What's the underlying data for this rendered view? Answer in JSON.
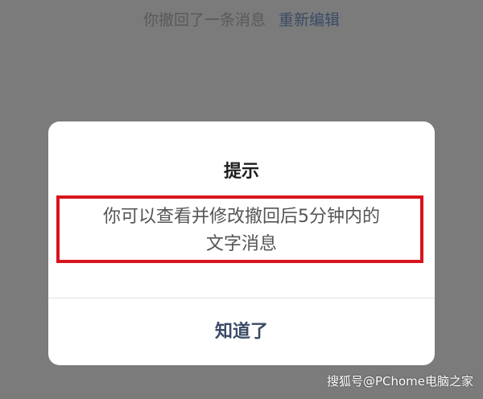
{
  "recall_notice": {
    "text": "你撤回了一条消息",
    "reedit_link": "重新编辑"
  },
  "dialog": {
    "title": "提示",
    "message_line1": "你可以查看并修改撤回后5分钟内的",
    "message_line2": "文字消息",
    "confirm_button": "知道了"
  },
  "watermark": {
    "text": "搜狐号@PChome电脑之家"
  },
  "colors": {
    "overlay": "#7b7b7b",
    "dialog_bg": "#ffffff",
    "highlight": "#d8141d",
    "link": "#3a4b66"
  }
}
